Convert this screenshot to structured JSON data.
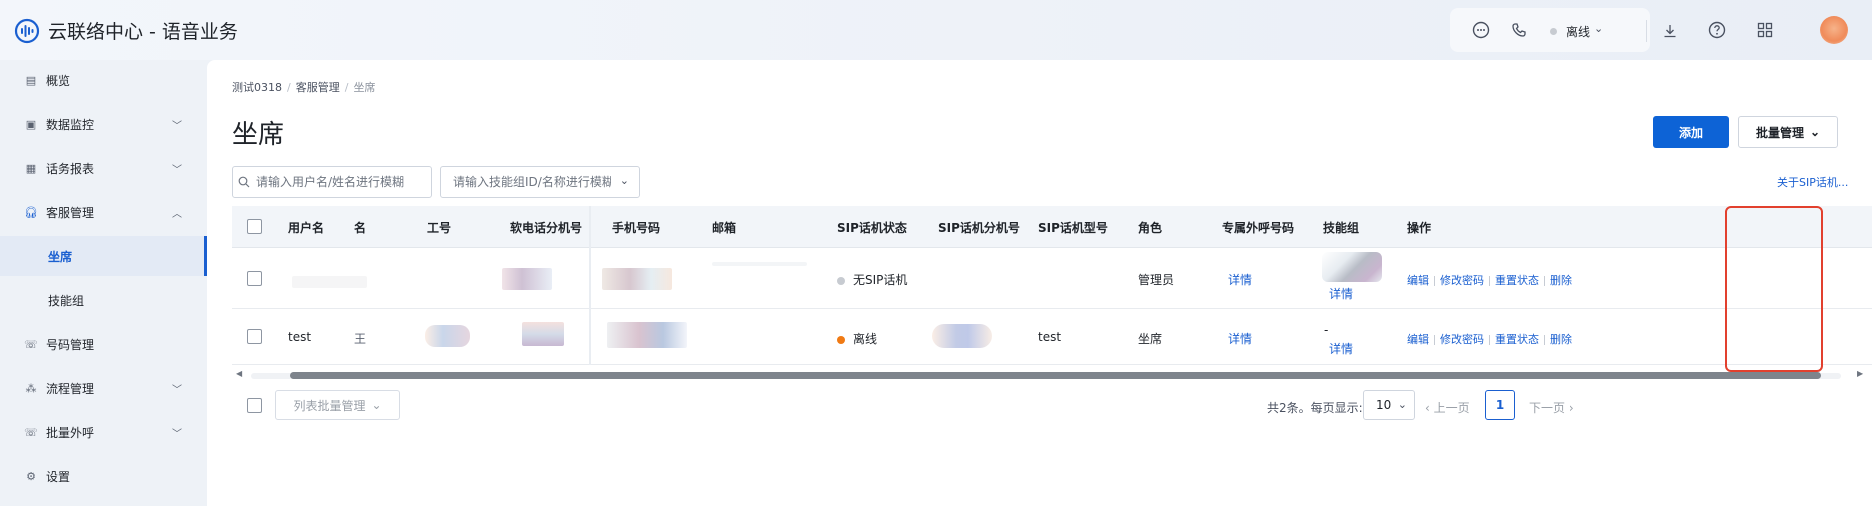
{
  "app": {
    "title": "云联络中心 - 语音业务"
  },
  "header": {
    "icons": [
      "chat-icon",
      "phone-icon",
      "download-icon",
      "help-icon",
      "grid-icon"
    ],
    "agent_status": "离线"
  },
  "sidebar": {
    "items": [
      {
        "label": "概览",
        "icon": "overview-icon"
      },
      {
        "label": "数据监控",
        "icon": "monitor-icon",
        "expandable": true
      },
      {
        "label": "话务报表",
        "icon": "report-icon",
        "expandable": true
      },
      {
        "label": "客服管理",
        "icon": "headset-icon",
        "expanded": true
      },
      {
        "label": "坐席",
        "sub": true,
        "active": true
      },
      {
        "label": "技能组",
        "sub": true
      },
      {
        "label": "号码管理",
        "icon": "phone-icon"
      },
      {
        "label": "流程管理",
        "icon": "flow-icon",
        "expandable": true
      },
      {
        "label": "批量外呼",
        "icon": "batch-call-icon",
        "expandable": true
      },
      {
        "label": "设置",
        "icon": "settings-icon"
      }
    ]
  },
  "breadcrumb": [
    "测试0318",
    "客服管理",
    "坐席"
  ],
  "page": {
    "title": "坐席"
  },
  "toolbar": {
    "add_label": "添加",
    "batch_label": "批量管理"
  },
  "search": {
    "user_placeholder": "请输入用户名/姓名进行模糊",
    "skill_placeholder": "请输入技能组ID/名称进行模糊",
    "sip_link": "关于SIP话机..."
  },
  "table": {
    "columns": [
      "用户名",
      "名",
      "工号",
      "软电话分机号",
      "手机号码",
      "邮箱",
      "SIP话机状态",
      "SIP话机分机号",
      "SIP话机型号",
      "角色",
      "专属外呼号码",
      "技能组",
      "操作"
    ],
    "rows": [
      {
        "username": "",
        "name": "",
        "sip_status": "无SIP话机",
        "sip_status_color": "#c7cbd1",
        "sip_model": "",
        "role": "管理员",
        "dedicated_number": "详情",
        "skill_group_value": "",
        "skill_group_link": "详情",
        "actions": [
          "编辑",
          "修改密码",
          "重置状态",
          "删除"
        ]
      },
      {
        "username": "test",
        "name": "王",
        "sip_status": "离线",
        "sip_status_color": "#f07a14",
        "sip_model": "test",
        "role": "坐席",
        "dedicated_number": "详情",
        "skill_group_value": "-",
        "skill_group_link": "详情",
        "actions": [
          "编辑",
          "修改密码",
          "重置状态",
          "删除"
        ]
      }
    ]
  },
  "footer": {
    "bulk_placeholder": "列表批量管理",
    "total_text": "共2条。每页显示:",
    "page_size": "10",
    "prev_label": "上一页",
    "current_page": "1",
    "next_label": "下一页"
  },
  "colors": {
    "primary": "#0d63d6",
    "highlight_box": "#e2402e"
  }
}
